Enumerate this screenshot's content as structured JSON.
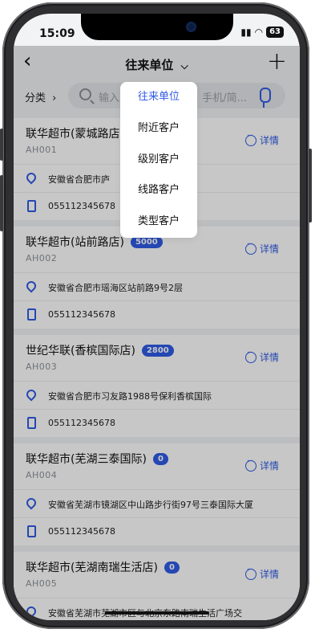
{
  "status_bar": {
    "time": "15:09",
    "battery": "63"
  },
  "nav": {
    "title": "往来单位",
    "title_arrow": "⌵",
    "back": "‹",
    "add": "+"
  },
  "filter": {
    "category_label": "分类",
    "category_arrow": "›",
    "search_placeholder": "输入",
    "search_placeholder_right": "手机/简..."
  },
  "dropdown": {
    "items": [
      "往来单位",
      "附近客户",
      "级别客户",
      "线路客户",
      "类型客户"
    ],
    "selected": "往来单位"
  },
  "customers": [
    {
      "name": "联华超市(蒙城路店)",
      "badge": "",
      "code": "AH001",
      "detail": "详情",
      "address": "安徽省合肥市庐",
      "phone": "055112345678"
    },
    {
      "name": "联华超市(站前路店)",
      "badge": "5000",
      "code": "AH002",
      "detail": "详情",
      "address": "安徽省合肥市瑶海区站前路9号2层",
      "phone": "055112345678"
    },
    {
      "name": "世纪华联(香槟国际店)",
      "badge": "2800",
      "code": "AH003",
      "detail": "详情",
      "address": "安徽省合肥市习友路1988号保利香槟国际",
      "phone": "055112345678"
    },
    {
      "name": "联华超市(芜湖三泰国际)",
      "badge": "0",
      "code": "AH004",
      "detail": "详情",
      "address": "安徽省芜湖市镜湖区中山路步行街97号三泰国际大厦",
      "phone": "055112345678"
    },
    {
      "name": "联华超市(芜湖南瑞生活店)",
      "badge": "0",
      "code": "AH005",
      "detail": "详情",
      "address": "安徽省芜湖市芜湖市区与北京东路南瑞生活广场交",
      "phone": ""
    }
  ],
  "colors": {
    "accent": "#2f5be6",
    "background": "#f1f3f5"
  }
}
